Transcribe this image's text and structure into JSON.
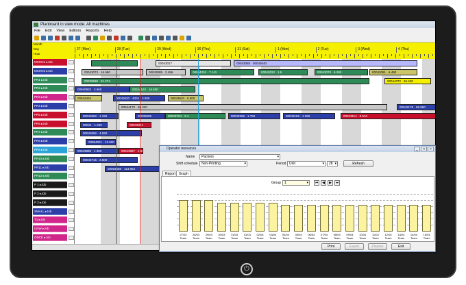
{
  "window": {
    "title": "Planboard in view mode: All machines",
    "menu": [
      "File",
      "Edit",
      "View",
      "Editors",
      "Reports",
      "Help"
    ]
  },
  "timeline": {
    "row_labels": [
      "Month",
      "Day",
      "Hour"
    ],
    "days": [
      "27 (Mon)",
      "28 (Tue)",
      "29 (Wed)",
      "30 (Thu)",
      "31 (Sat)",
      "1 (Mon)",
      "2 (Tue)",
      "3 (Wed)",
      "4 (Thu)"
    ]
  },
  "resources": [
    {
      "label": "MCHN1 ▸Job",
      "color": "#c8102e"
    },
    {
      "label": "MCHN2 ▸Job",
      "color": "#2c3ea8"
    },
    {
      "label": "PR1 ▸Job",
      "color": "#2e8b57"
    },
    {
      "label": "PR2 ▸Job",
      "color": "#2e8b57"
    },
    {
      "label": "PR3 ▸Job",
      "color": "#d0268c"
    },
    {
      "label": "PR4 ▸Job",
      "color": "#2c3ea8"
    },
    {
      "label": "PR5 ▸Job",
      "color": "#c8102e"
    },
    {
      "label": "PR6 ▸Job",
      "color": "#c8102e"
    },
    {
      "label": "PR7 ▸Job",
      "color": "#2e8b57"
    },
    {
      "label": "PR8 ▸Job",
      "color": "#2c3ea8"
    },
    {
      "label": "PR9 ▸Job",
      "color": "#2aa4d8"
    },
    {
      "label": "PR10 ▸Job",
      "color": "#2e8b57"
    },
    {
      "label": "PR11 ▸Job",
      "color": "#2c3ea8"
    },
    {
      "label": "PR12 ▸Job",
      "color": "#2e8b57"
    },
    {
      "label": "P 1 ▸Job",
      "color": "#1a1a1a"
    },
    {
      "label": "P 2 ▸Job",
      "color": "#1a1a1a"
    },
    {
      "label": "P 3 ▸Job",
      "color": "#1a1a1a"
    },
    {
      "label": "SMALL ▸Job",
      "color": "#2c3ea8"
    },
    {
      "label": "T1 ▸Job",
      "color": "#d0268c"
    },
    {
      "label": "UNW ▸Job",
      "color": "#d0268c"
    },
    {
      "label": "ONCE ▸Job",
      "color": "#d0268c"
    }
  ],
  "gantt_bars": [
    {
      "row": 0,
      "start": 24,
      "end": 92,
      "text": "",
      "color": "#2e8b57"
    },
    {
      "row": 0,
      "start": 118,
      "end": 228,
      "text": "00043017",
      "color": "#e6e6e6"
    },
    {
      "row": 0,
      "start": 232,
      "end": 500,
      "text": "00043085 · 00043040",
      "color": "#b8b8ff"
    },
    {
      "row": 1,
      "start": 10,
      "end": 100,
      "text": "00043073 · 16.960",
      "color": "#c8c8c8"
    },
    {
      "row": 1,
      "start": 104,
      "end": 162,
      "text": "00043085 · 2.456",
      "color": "#c8c8c8"
    },
    {
      "row": 1,
      "start": 168,
      "end": 262,
      "text": "00044201 · 7.141",
      "color": "#2e8b57"
    },
    {
      "row": 1,
      "start": 268,
      "end": 340,
      "text": "00043022 · 1.5",
      "color": "#2e8b57"
    },
    {
      "row": 1,
      "start": 350,
      "end": 428,
      "text": "00043070 · 6.280",
      "color": "#2e8b57"
    },
    {
      "row": 1,
      "start": 430,
      "end": 500,
      "text": "00043081 · 6.490",
      "color": "#c9c36a"
    },
    {
      "row": 2,
      "start": 10,
      "end": 430,
      "text": "00029690 · 91.274",
      "color": "#2e8b57"
    },
    {
      "row": 2,
      "start": 452,
      "end": 520,
      "text": "00044072 · 26.420",
      "color": "#f5f000"
    },
    {
      "row": 3,
      "start": 0,
      "end": 80,
      "text": "00040903 · 3.960",
      "color": "#2c3ea8"
    },
    {
      "row": 3,
      "start": 80,
      "end": 176,
      "text": "00044163 · 16.500",
      "color": "#2e8b57"
    },
    {
      "row": 4,
      "start": 0,
      "end": 40,
      "text": "00042404",
      "color": "#c9c36a"
    },
    {
      "row": 4,
      "start": 56,
      "end": 132,
      "text": "00043620 · 4004 · 3.000",
      "color": "#2c3ea8"
    },
    {
      "row": 4,
      "start": 136,
      "end": 188,
      "text": "00043620 · 5.000",
      "color": "#c9c36a"
    },
    {
      "row": 5,
      "start": 64,
      "end": 456,
      "text": "00044170 · 55.320",
      "color": "#c8c8c8"
    },
    {
      "row": 5,
      "start": 470,
      "end": 528,
      "text": "00042178 · 59.960",
      "color": "#2c3ea8"
    },
    {
      "row": 6,
      "start": 8,
      "end": 64,
      "text": "00043652 · 1.195",
      "color": "#2c3ea8"
    },
    {
      "row": 6,
      "start": 88,
      "end": 132,
      "text": "00030609",
      "color": "#2c3ea8"
    },
    {
      "row": 6,
      "start": 132,
      "end": 220,
      "text": "00043704 · 3.4",
      "color": "#2e8b57"
    },
    {
      "row": 6,
      "start": 224,
      "end": 300,
      "text": "00043265 · 1.750",
      "color": "#2c3ea8"
    },
    {
      "row": 6,
      "start": 304,
      "end": 380,
      "text": "00043156 · 1.350",
      "color": "#2c3ea8"
    },
    {
      "row": 6,
      "start": 388,
      "end": 528,
      "text": "00043114 · 8.510",
      "color": "#c8102e"
    },
    {
      "row": 7,
      "start": 8,
      "end": 48,
      "text": "00041 · 1.260",
      "color": "#2c3ea8"
    },
    {
      "row": 7,
      "start": 76,
      "end": 112,
      "text": "00043341",
      "color": "#c8102e"
    },
    {
      "row": 8,
      "start": 8,
      "end": 98,
      "text": "00043692 · 4.830",
      "color": "#2c3ea8"
    },
    {
      "row": 9,
      "start": 16,
      "end": 60,
      "text": "00054021 · 12.600",
      "color": "#2c3ea8"
    },
    {
      "row": 10,
      "start": 0,
      "end": 64,
      "text": "00043898 · 1.350",
      "color": "#2c3ea8"
    },
    {
      "row": 10,
      "start": 64,
      "end": 100,
      "text": "00043897 · 1.800",
      "color": "#c8102e"
    },
    {
      "row": 11,
      "start": 8,
      "end": 92,
      "text": "00043715 · 2.500",
      "color": "#2c3ea8"
    },
    {
      "row": 12,
      "start": 44,
      "end": 130,
      "text": "00053608 · 113.853",
      "color": "#2c3ea8"
    }
  ],
  "dialog": {
    "title": "Operator resources",
    "fields": {
      "name_label": "Name",
      "name_value": "Packers",
      "shift_label": "Shift schedule",
      "shift_value": "Non-Printing",
      "period_label": "Period",
      "period_value": "Unit",
      "period_num": "28",
      "refresh": "Refresh"
    },
    "tabs": [
      "Report",
      "Graph"
    ],
    "group_label": "Group",
    "group_value": "1",
    "buttons": {
      "print": "Print",
      "export": "Export",
      "planner": "Planner",
      "exit": "Exit"
    }
  },
  "chart_data": {
    "type": "bar",
    "title": "",
    "categories": [
      "27/03 Team",
      "28/03 Team",
      "29/03 Team",
      "30/03 Team",
      "31/03 Team",
      "01/04 Team",
      "02/04 Team",
      "03/04 Team",
      "04/04 Team",
      "05/04 Team",
      "06/04 Team",
      "07/04 Team",
      "08/04 Team",
      "09/04 Team",
      "10/04 Team",
      "11/04 Team",
      "12/04 Team",
      "13/04 Team",
      "14/04 Team",
      "15/04 Team"
    ],
    "values": [
      12,
      12,
      12,
      11,
      11,
      11,
      11,
      11,
      10,
      10,
      10,
      10,
      10,
      10,
      10,
      10,
      10,
      10,
      10,
      10
    ],
    "ylim": [
      0,
      14
    ],
    "gridlines": true
  }
}
